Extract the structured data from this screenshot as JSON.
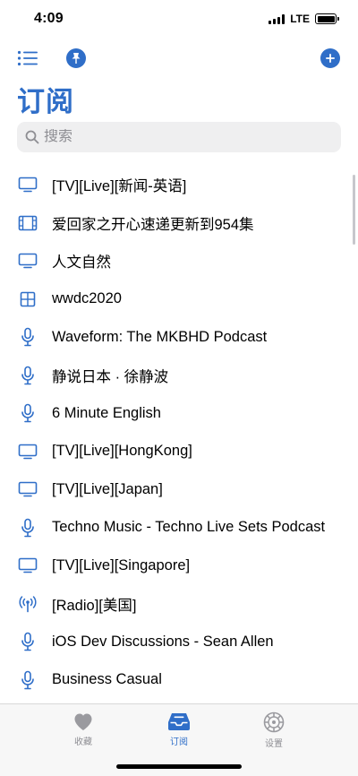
{
  "status": {
    "time": "4:09",
    "network": "LTE"
  },
  "header": {
    "title": "订阅"
  },
  "search": {
    "placeholder": "搜索"
  },
  "colors": {
    "accent": "#2f6ec8",
    "search_bg": "#efeff0",
    "tabbar_bg": "#f7f7f7",
    "inactive": "#8e8e93"
  },
  "subscriptions": [
    {
      "icon": "tv-icon",
      "label": "[TV][Live][新闻-英语]"
    },
    {
      "icon": "film-icon",
      "label": "爱回家之开心速递更新到954集"
    },
    {
      "icon": "tv-icon",
      "label": "人文自然"
    },
    {
      "icon": "grid-icon",
      "label": "wwdc2020"
    },
    {
      "icon": "mic-icon",
      "label": "Waveform: The MKBHD Podcast"
    },
    {
      "icon": "mic-icon",
      "label": "静说日本 · 徐静波"
    },
    {
      "icon": "mic-icon",
      "label": "6 Minute English"
    },
    {
      "icon": "tv-icon",
      "label": "[TV][Live][HongKong]"
    },
    {
      "icon": "tv-icon",
      "label": "[TV][Live][Japan]"
    },
    {
      "icon": "mic-icon",
      "label": "Techno Music - Techno Live Sets Podcast"
    },
    {
      "icon": "tv-icon",
      "label": "[TV][Live][Singapore]"
    },
    {
      "icon": "radio-icon",
      "label": "[Radio][美国]"
    },
    {
      "icon": "mic-icon",
      "label": "iOS Dev Discussions - Sean Allen"
    },
    {
      "icon": "mic-icon",
      "label": "Business Casual"
    }
  ],
  "tabbar": {
    "favorites": {
      "label": "收藏",
      "icon": "heart-icon"
    },
    "subscriptions": {
      "label": "订阅",
      "icon": "inbox-tray-icon",
      "active": true
    },
    "settings": {
      "label": "设置",
      "icon": "gear-icon"
    }
  }
}
